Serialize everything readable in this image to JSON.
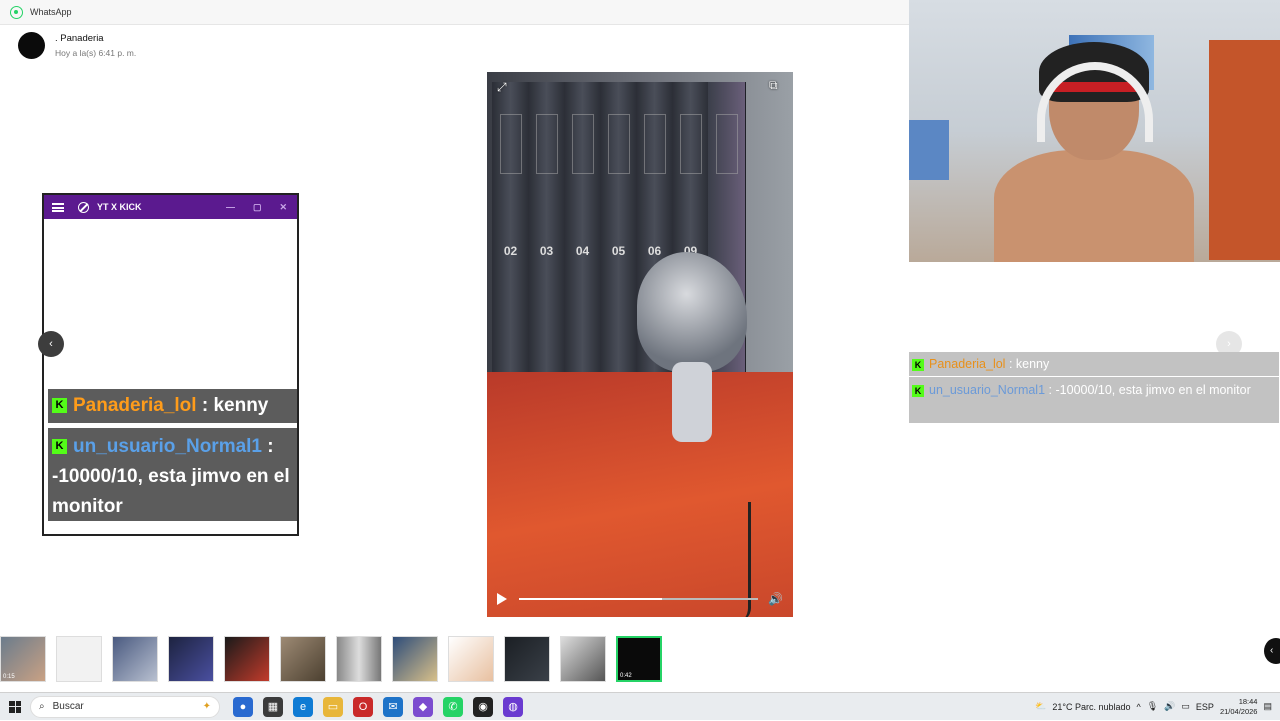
{
  "whatsapp": {
    "app_title": "WhatsApp"
  },
  "contact": {
    "name": ". Panaderia",
    "time": "Hoy a la(s) 6:41 p. m."
  },
  "viewer": {
    "expand_icon": "expand-icon",
    "share_icon": "open-external-icon",
    "book_numbers": [
      "02",
      "03",
      "04",
      "05",
      "06",
      "09"
    ],
    "progress": 0.6,
    "play_icon": "play-icon",
    "volume_icon": "volume-icon"
  },
  "kick_window": {
    "title": "YT X KICK",
    "messages": [
      {
        "user": "Panaderia_lol",
        "sep": ":",
        "text": "kenny",
        "user_color": "#ff9c1a"
      },
      {
        "user": "un_usuario_Normal1",
        "sep": ":",
        "text": "-10000/10, esta jimvo en el monitor",
        "user_color": "#5aa0e8"
      }
    ]
  },
  "side_chat": {
    "messages": [
      {
        "user": "Panaderia_lol",
        "sep": ":",
        "text": "kenny"
      },
      {
        "user": "un_usuario_Normal1",
        "sep": ":",
        "text": "-10000/10, esta jimvo en el monitor"
      }
    ]
  },
  "nav": {
    "prev": "‹",
    "next": "›"
  },
  "thumbnails": [
    {
      "duration": "0:15"
    },
    {
      "duration": ""
    },
    {
      "duration": ""
    },
    {
      "duration": ""
    },
    {
      "duration": ""
    },
    {
      "duration": ""
    },
    {
      "duration": ""
    },
    {
      "duration": ""
    },
    {
      "duration": ""
    },
    {
      "duration": ""
    },
    {
      "duration": ""
    },
    {
      "duration": "0:42",
      "selected": true
    }
  ],
  "taskbar": {
    "search_placeholder": "Buscar",
    "weather": "21°C  Parc. nublado",
    "language": "ESP",
    "time": "18:44",
    "date": "21/04/2026"
  }
}
